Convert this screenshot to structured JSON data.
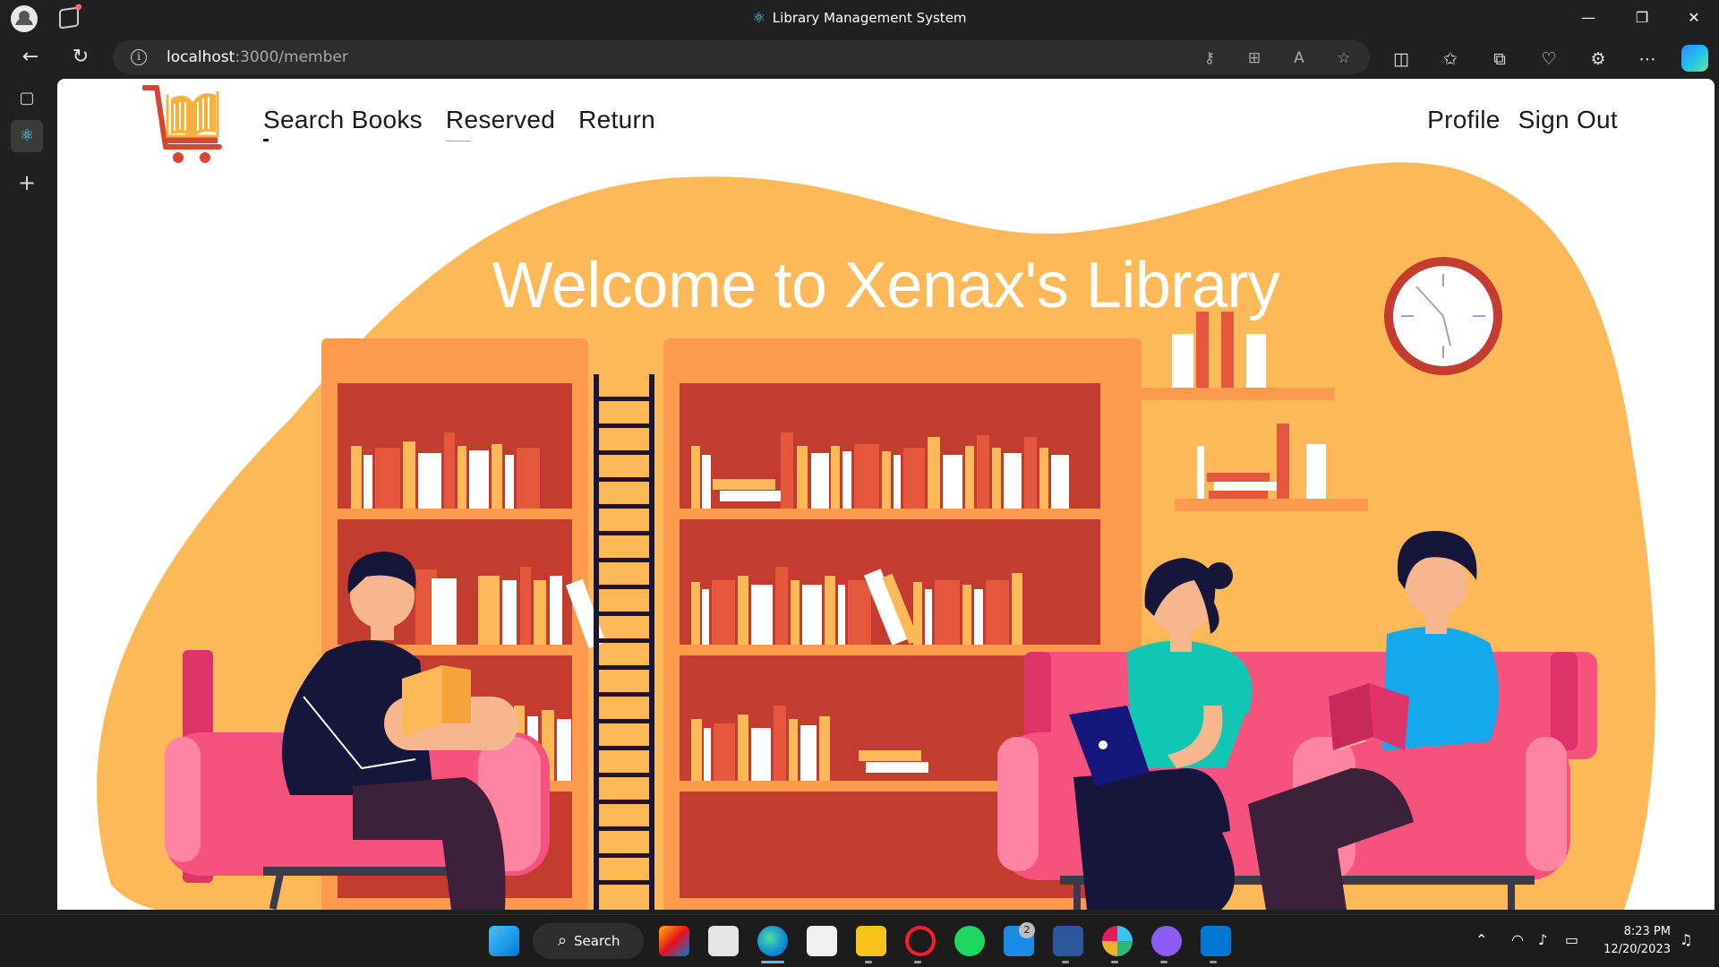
{
  "browser": {
    "window_title": "Library Management System",
    "url_host": "localhost",
    "url_path": ":3000/member"
  },
  "nav": {
    "left_links": [
      "Search Books",
      "Reserved",
      "Return"
    ],
    "right_links": [
      "Profile",
      "Sign Out"
    ]
  },
  "hero": {
    "heading": "Welcome to Xenax's Library"
  },
  "taskbar": {
    "search_label": "Search",
    "mail_badge": "2",
    "time": "8:23 PM",
    "date": "12/20/2023"
  },
  "colors": {
    "blob": "#fdb958",
    "shelf": "#fe9a4e",
    "shelf_back": "#c43c30",
    "sofa": "#f5527e",
    "logo_red": "#d64632",
    "logo_yellow": "#fbb03b"
  }
}
